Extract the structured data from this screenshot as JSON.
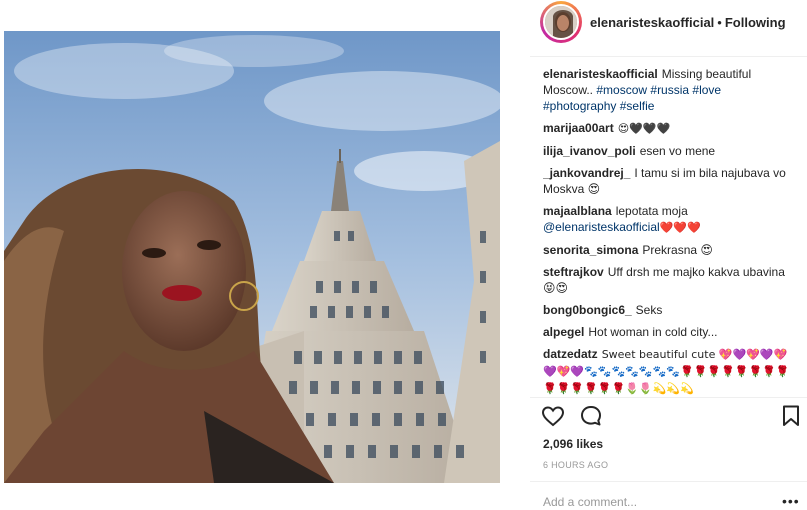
{
  "post": {
    "username": "elenaristeskaofficial",
    "separator": "•",
    "follow_status": "Following",
    "caption": {
      "text": "Missing beautiful Moscow..",
      "hashtags": [
        "#moscow",
        "#russia",
        "#love",
        "#photography",
        "#selfie"
      ]
    },
    "comments": [
      {
        "user": "marijaa00art",
        "text": "😍🖤🖤🖤"
      },
      {
        "user": "ilija_ivanov_poli",
        "text": "esen vo mene"
      },
      {
        "user": "_jankovandrej_",
        "text": "I tamu si im bila najubava vo Moskva 😍"
      },
      {
        "user": "majaalblana",
        "text": "lepotata moja",
        "mention": "@elenaristeskaofficial",
        "suffix": "❤️❤️❤️"
      },
      {
        "user": "senorita_simona",
        "text": "Prekrasna 😍"
      },
      {
        "user": "steftrajkov",
        "text": "Uff drsh me majko kakva ubavina 😝😍"
      },
      {
        "user": "bong0bongic6_",
        "text": "Seks"
      },
      {
        "user": "alpegel",
        "text": "Hot woman in cold city..."
      },
      {
        "user": "datzedatz",
        "text": "Sweet beautiful cute 💖💜💖💜💖💜💖💜🐾🐾🐾🐾🐾🐾🐾🌹🌹🌹🌹🌹🌹🌹🌹🌹🌹🌹🌹🌹🌹🌷🌷💫💫💫"
      }
    ],
    "likes": "2,096 likes",
    "timestamp": "6 HOURS AGO",
    "add_comment_placeholder": "Add a comment...",
    "more_options": "•••"
  },
  "icons": {
    "like": "heart-outline-icon",
    "comment": "speech-bubble-icon",
    "save": "bookmark-icon"
  },
  "colors": {
    "text": "#262626",
    "hashtag": "#003569",
    "muted": "#999999",
    "heart_red": "#b1182b"
  }
}
